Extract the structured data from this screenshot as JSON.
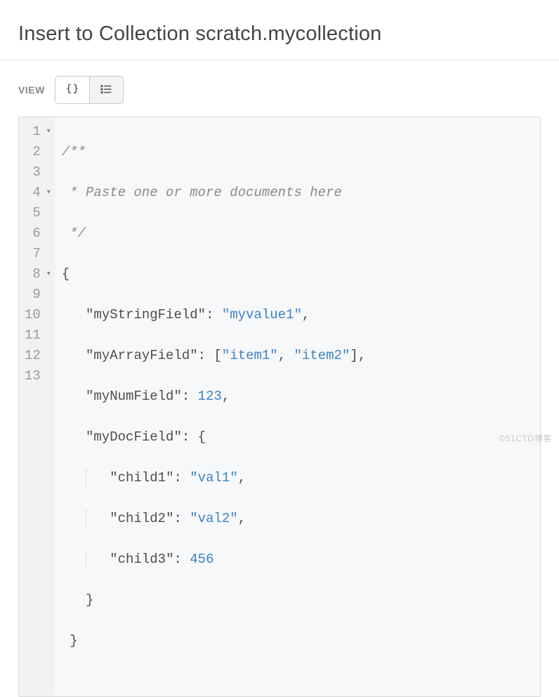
{
  "header": {
    "title": "Insert to Collection scratch.mycollection"
  },
  "toolbar": {
    "view_label": "VIEW"
  },
  "editor": {
    "lines": {
      "l1": "/**",
      "l2": " * Paste one or more documents here",
      "l3": " */",
      "l4": "{",
      "l5_key": "\"myStringField\"",
      "l5_val": "\"myvalue1\"",
      "l6_key": "\"myArrayField\"",
      "l6_v1": "\"item1\"",
      "l6_v2": "\"item2\"",
      "l7_key": "\"myNumField\"",
      "l7_val": "123",
      "l8_key": "\"myDocField\"",
      "l9_key": "\"child1\"",
      "l9_val": "\"val1\"",
      "l10_key": "\"child2\"",
      "l10_val": "\"val2\"",
      "l11_key": "\"child3\"",
      "l11_val": "456",
      "l12": "}",
      "l13": "}"
    },
    "line_numbers": [
      "1",
      "2",
      "3",
      "4",
      "5",
      "6",
      "7",
      "8",
      "9",
      "10",
      "11",
      "12",
      "13"
    ]
  },
  "watermark": "©51CTO博客"
}
